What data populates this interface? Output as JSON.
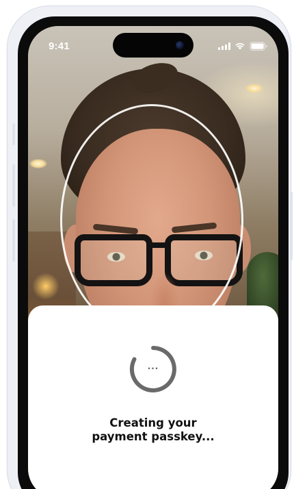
{
  "status_bar": {
    "time": "9:41",
    "icons": [
      "signal-icon",
      "wifi-icon",
      "battery-icon"
    ]
  },
  "camera": {
    "face_guide": "oval-face-guide"
  },
  "sheet": {
    "spinner_text": "...",
    "message_line1": "Creating your",
    "message_line2": "payment passkey..."
  },
  "colors": {
    "sheet_background": "#ffffff",
    "spinner": "#6a6a6a",
    "message_text": "#111111",
    "oval_guide": "#ffffff"
  }
}
